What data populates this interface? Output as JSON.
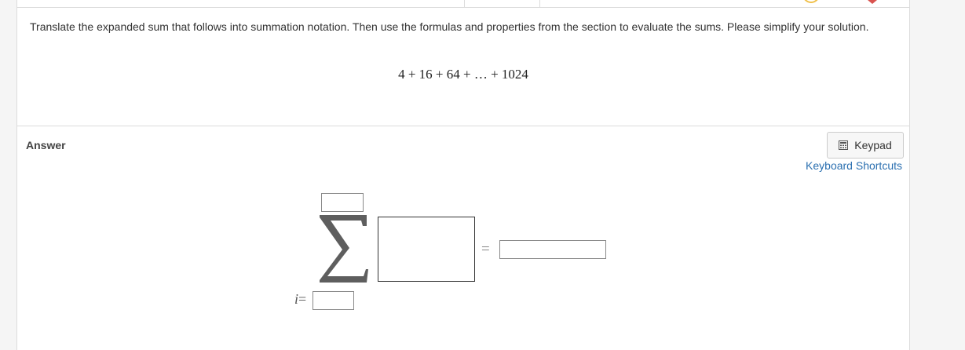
{
  "question": {
    "instructions": "Translate the expanded sum that follows into summation notation. Then use the formulas and properties from the section to evaluate the sums. Please simplify your solution.",
    "expression": "4 + 16 + 64 + … + 1024"
  },
  "answer": {
    "label": "Answer",
    "keypad_label": "Keypad",
    "shortcuts_label": "Keyboard Shortcuts",
    "index_variable": "i",
    "index_equals": "=",
    "result_equals": "=",
    "upper_limit_value": "",
    "lower_limit_value": "",
    "summand_value": "",
    "result_value": ""
  },
  "icons": {
    "keypad": "calculator-icon",
    "sigma": "sigma-icon"
  },
  "colors": {
    "link": "#2a6fb0",
    "indicator": "#f0c04a",
    "flag": "#d9534f"
  }
}
